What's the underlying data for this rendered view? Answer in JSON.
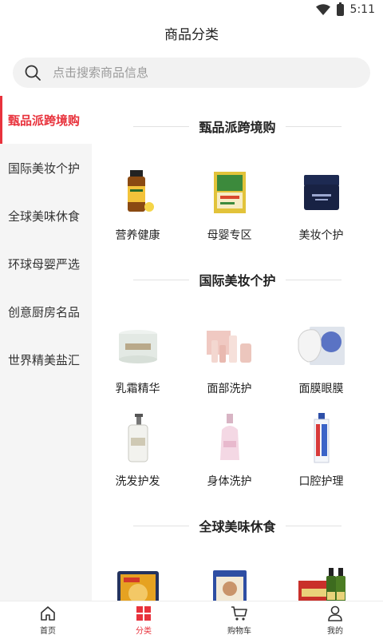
{
  "status": {
    "time": "5:11",
    "icons": [
      "wifi-icon",
      "battery-icon"
    ]
  },
  "header": {
    "title": "商品分类"
  },
  "search": {
    "placeholder": "点击搜索商品信息",
    "icon": "search-icon"
  },
  "colors": {
    "accent": "#e8323c",
    "sidebar_bg": "#f5f5f5"
  },
  "sidebar": {
    "items": [
      {
        "label": "甄品派跨境购",
        "active": true
      },
      {
        "label": "国际美妆个护",
        "active": false
      },
      {
        "label": "全球美味休食",
        "active": false
      },
      {
        "label": "环球母婴严选",
        "active": false
      },
      {
        "label": "创意厨房名品",
        "active": false
      },
      {
        "label": "世界精美盐汇",
        "active": false
      }
    ]
  },
  "sections": [
    {
      "title": "甄品派跨境购",
      "items": [
        {
          "label": "营养健康",
          "image": "supplement-bottle"
        },
        {
          "label": "母婴专区",
          "image": "baby-product-box"
        },
        {
          "label": "美妆个护",
          "image": "cream-jar-navy"
        }
      ]
    },
    {
      "title": "国际美妆个护",
      "items": [
        {
          "label": "乳霜精华",
          "image": "la-mer-cream"
        },
        {
          "label": "面部洗护",
          "image": "face-care-set"
        },
        {
          "label": "面膜眼膜",
          "image": "sheet-mask"
        },
        {
          "label": "洗发护发",
          "image": "pump-bottle"
        },
        {
          "label": "身体洗护",
          "image": "body-lotion-bottle"
        },
        {
          "label": "口腔护理",
          "image": "toothpaste-tube"
        }
      ]
    },
    {
      "title": "全球美味休食",
      "items": [
        {
          "label": "",
          "image": "cookie-tin"
        },
        {
          "label": "",
          "image": "snack-bag"
        },
        {
          "label": "",
          "image": "olive-oil-giftbox"
        }
      ]
    }
  ],
  "tabbar": {
    "items": [
      {
        "label": "首页",
        "icon": "home-icon",
        "active": false
      },
      {
        "label": "分类",
        "icon": "category-icon",
        "active": true
      },
      {
        "label": "购物车",
        "icon": "cart-icon",
        "active": false
      },
      {
        "label": "我的",
        "icon": "user-icon",
        "active": false
      }
    ]
  }
}
